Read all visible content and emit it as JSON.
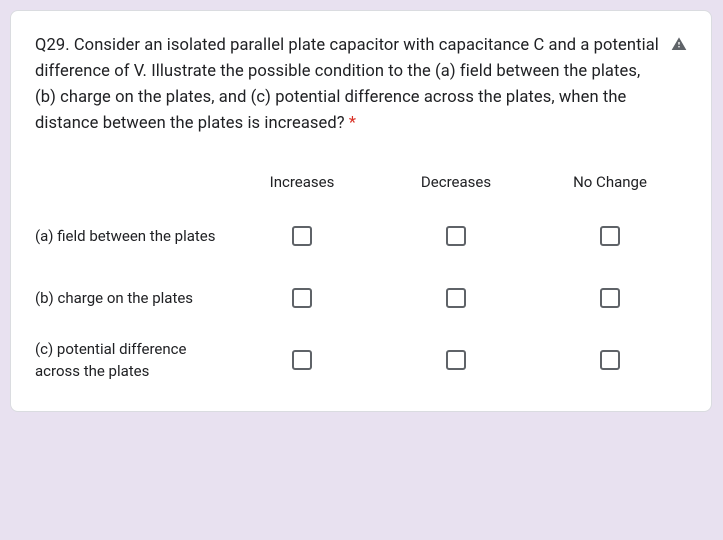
{
  "question": {
    "text": "Q29. Consider an isolated parallel plate capacitor with capacitance C and a potential difference of V. Illustrate the possible condition to the (a) field between the plates, (b) charge on the plates, and (c) potential difference across the plates, when the distance between the plates is increased?",
    "required_mark": " *"
  },
  "columns": {
    "c0": "Increases",
    "c1": "Decreases",
    "c2": "No Change"
  },
  "rows": {
    "r0": "(a) field between the plates",
    "r1": "(b) charge on the plates",
    "r2": "(c) potential difference across the plates"
  },
  "chart_data": {
    "type": "table",
    "columns": [
      "Increases",
      "Decreases",
      "No Change"
    ],
    "rows": [
      {
        "label": "(a) field between the plates",
        "values": [
          false,
          false,
          false
        ]
      },
      {
        "label": "(b) charge on the plates",
        "values": [
          false,
          false,
          false
        ]
      },
      {
        "label": "(c) potential difference across the plates",
        "values": [
          false,
          false,
          false
        ]
      }
    ]
  }
}
